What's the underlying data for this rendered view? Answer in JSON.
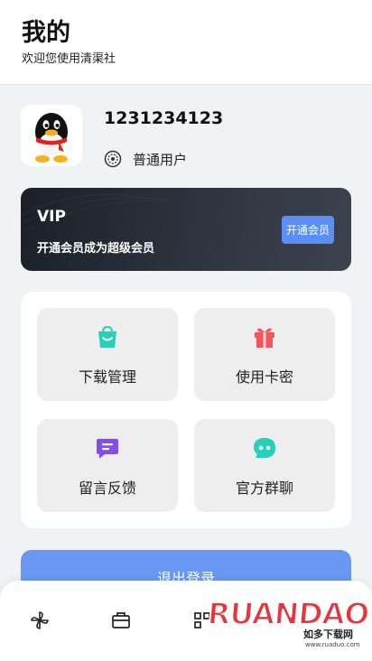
{
  "header": {
    "title": "我的",
    "subtitle": "欢迎您使用清渠社"
  },
  "profile": {
    "user_id": "1231234123",
    "role": "普通用户",
    "avatar_icon": "qq-penguin-icon",
    "role_icon": "badge-icon"
  },
  "vip": {
    "title": "VIP",
    "description": "开通会员成为超级会员",
    "button_label": "开通会员"
  },
  "menu": {
    "items": [
      {
        "label": "下载管理",
        "icon": "shopping-bag-icon",
        "color": "#27d0b8"
      },
      {
        "label": "使用卡密",
        "icon": "gift-icon",
        "color": "#f2545b"
      },
      {
        "label": "留言反馈",
        "icon": "message-icon",
        "color": "#8250e8"
      },
      {
        "label": "官方群聊",
        "icon": "chat-bubble-icon",
        "color": "#27d0b8"
      }
    ]
  },
  "logout": {
    "label": "退出登录"
  },
  "tabbar": {
    "items": [
      {
        "icon": "pinwheel-icon"
      },
      {
        "icon": "toolbox-icon"
      },
      {
        "icon": "grid-icon"
      }
    ]
  },
  "watermark": {
    "text": "RUANDAO",
    "sub": "如多下载网",
    "url": "www.ruaduo.com"
  },
  "colors": {
    "accent": "#5b8ff5",
    "background": "#f1f2f4",
    "vip_dark": "#1a2027"
  }
}
